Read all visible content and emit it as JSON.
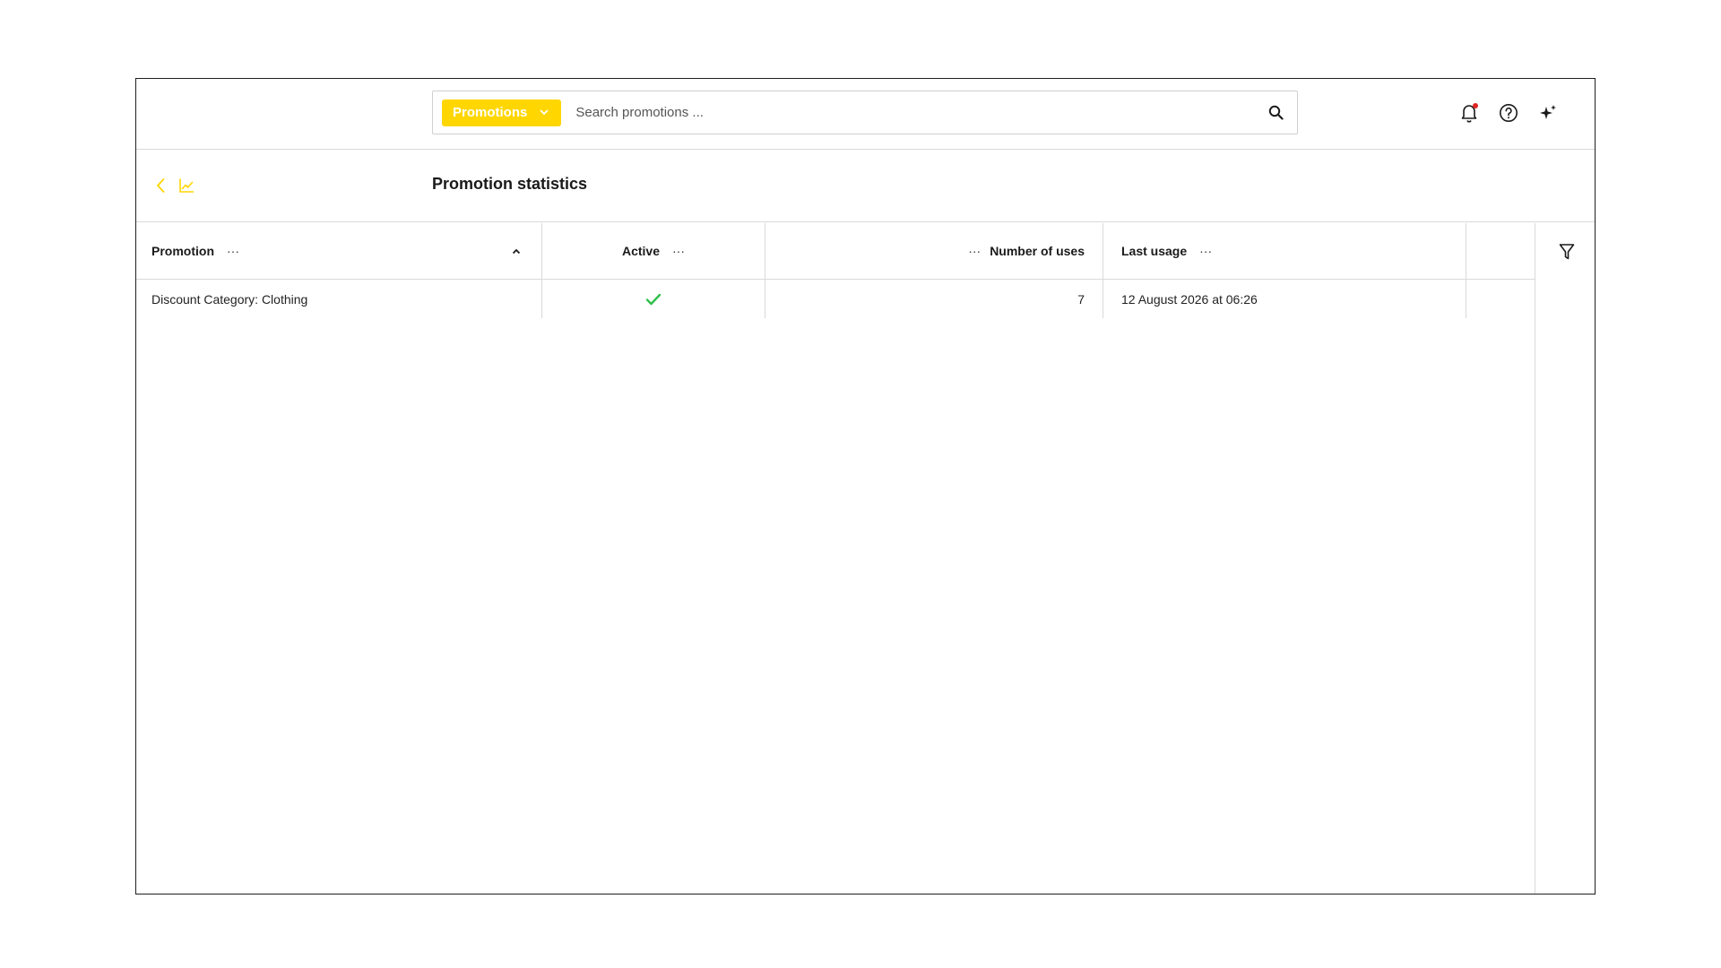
{
  "search": {
    "scope_label": "Promotions",
    "placeholder": "Search promotions ..."
  },
  "page": {
    "title": "Promotion statistics"
  },
  "table": {
    "columns": [
      {
        "label": "Promotion"
      },
      {
        "label": "Active"
      },
      {
        "label": "Number of uses"
      },
      {
        "label": "Last usage"
      }
    ],
    "rows": [
      {
        "promotion": "Discount Category: Clothing",
        "active": true,
        "uses": "7",
        "last_usage": "12 August 2026 at 06:26"
      }
    ]
  },
  "ui": {
    "column_menu_glyph": "···"
  },
  "icons": {
    "search": "search-icon",
    "notifications": "bell-icon",
    "help": "help-icon",
    "ai": "sparkle-icon",
    "back": "chevron-left-icon",
    "chart": "line-chart-icon",
    "filter": "filter-icon",
    "check": "check-icon"
  },
  "colors": {
    "accent": "#ffd600",
    "notification_dot": "#e02424",
    "check": "#2fbf4a"
  }
}
